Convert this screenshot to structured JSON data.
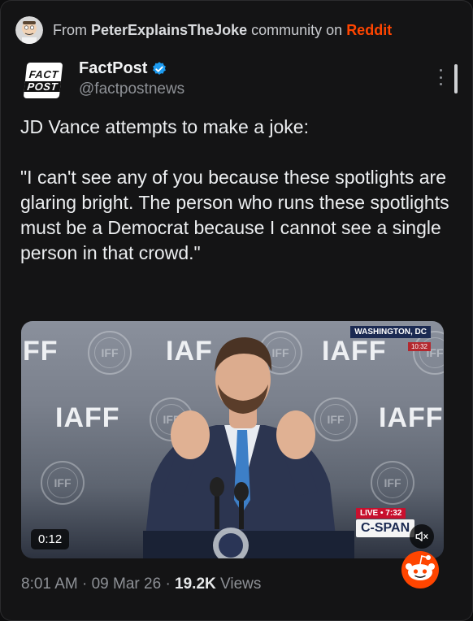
{
  "banner": {
    "from": "From",
    "community": "PeterExplainsTheJoke",
    "middle": "community on",
    "platform": "Reddit"
  },
  "account": {
    "logo_line1": "FACT",
    "logo_line2": "POST",
    "name": "FactPost",
    "handle": "@factpostnews",
    "verified": true
  },
  "tweet": {
    "line1": "JD Vance attempts to make a joke:",
    "quote": "\"I can't see any of you because these spotlights are glaring bright. The person who runs these spotlights must be a Democrat because I cannot see a single person in that crowd.\""
  },
  "video": {
    "backdrop_text": "IAFF",
    "backdrop_partial_left": "FF",
    "backdrop_partial_mid": "IAF",
    "seal_text": "IFF",
    "chyron_location": "WASHINGTON, DC",
    "chyron_time": "10:32",
    "live_label": "LIVE",
    "live_time": "7:32",
    "network": "C-SPAN",
    "duration": "0:12",
    "mute_icon": "speaker-mute-icon"
  },
  "meta": {
    "time": "8:01 AM",
    "sep1": "·",
    "date": "09 Mar 26",
    "sep2": "·",
    "views_count": "19.2K",
    "views_label": "Views"
  },
  "colors": {
    "background": "#141415",
    "reddit": "#ff4500",
    "verified": "#1d9bf0",
    "muted_text": "#8e9196"
  }
}
